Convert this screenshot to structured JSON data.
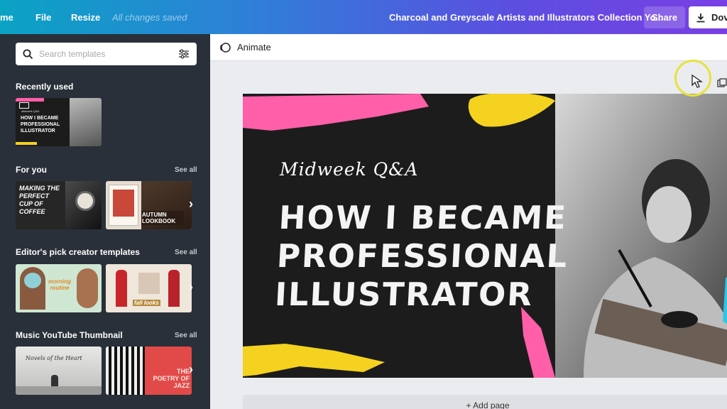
{
  "topbar": {
    "home_label": "me",
    "file_label": "File",
    "resize_label": "Resize",
    "saved_status": "All changes saved",
    "document_title": "Charcoal and Greyscale Artists and Illustrators Collection Yo...",
    "share_label": "Share",
    "download_label": "Dov"
  },
  "sidebar": {
    "search_placeholder": "Search templates",
    "sections": [
      {
        "title": "Recently used",
        "see_all": ""
      },
      {
        "title": "For you",
        "see_all": "See all"
      },
      {
        "title": "Editor's pick creator templates",
        "see_all": "See all"
      },
      {
        "title": "Music YouTube Thumbnail",
        "see_all": "See all"
      }
    ],
    "thumbs": {
      "recent_1": "HOW I BECAME PROFESSIONAL ILLUSTRATOR",
      "recent_1_small": "Midweek Q&A",
      "foryou_1": "MAKING THE PERFECT CUP OF COFFEE",
      "foryou_2": "AUTUMN LOOKBOOK",
      "pick_1": "morning routine",
      "pick_2": "fall looks",
      "music_1": "Novels of the Heart",
      "music_2": "THE POETRY OF JAZZ"
    }
  },
  "toolbar": {
    "animate_label": "Animate"
  },
  "design": {
    "subtitle": "Midweek Q&A",
    "headline_lines": [
      "HOW I BECAME",
      "PROFESSIONAL",
      "ILLUSTRATOR"
    ]
  },
  "add_page_label": "+ Add page",
  "colors": {
    "brush_pink": "#ff5fa8",
    "brush_yellow": "#f4d21f",
    "brush_cyan": "#2dc6e8",
    "panel_bg": "#293039"
  }
}
